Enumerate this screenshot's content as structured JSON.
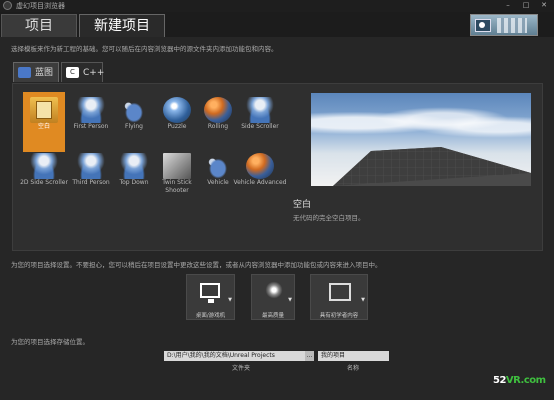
{
  "window": {
    "title": "虚幻项目浏览器",
    "controls": [
      "–",
      "□",
      "✕"
    ]
  },
  "tabs": [
    {
      "label": "项目",
      "active": false
    },
    {
      "label": "新建项目",
      "active": true
    }
  ],
  "description": "选择模板来作为新工程的基础。您可以随后在内容浏览器中的源文件夹内添加功能包和内容。",
  "blueprint_tabs": [
    {
      "label": "蓝图",
      "icon": "blueprint-icon",
      "active": true
    },
    {
      "label": "C++",
      "icon": "cpp-icon",
      "active": false
    }
  ],
  "templates": [
    {
      "label": "空白",
      "icon": "blank-template-icon",
      "selected": true
    },
    {
      "label": "First Person",
      "icon": "first-person-icon"
    },
    {
      "label": "Flying",
      "icon": "flying-icon"
    },
    {
      "label": "Puzzle",
      "icon": "puzzle-icon"
    },
    {
      "label": "Rolling",
      "icon": "rolling-icon"
    },
    {
      "label": "Side Scroller",
      "icon": "side-scroller-icon"
    },
    {
      "label": "2D Side Scroller",
      "icon": "2d-side-scroller-icon"
    },
    {
      "label": "Third Person",
      "icon": "third-person-icon"
    },
    {
      "label": "Top Down",
      "icon": "top-down-icon"
    },
    {
      "label": "Twin Stick Shooter",
      "icon": "twin-stick-shooter-icon"
    },
    {
      "label": "Vehicle",
      "icon": "vehicle-icon"
    },
    {
      "label": "Vehicle Advanced",
      "icon": "vehicle-advanced-icon"
    }
  ],
  "preview": {
    "title": "空白",
    "description": "无代码的完全空白项目。"
  },
  "settings_heading": "为您的项目选择设置。不要担心，您可以稍后在项目设置中更改这些设置，或者从内容浏览器中添加功能包或内容来进入项目中。",
  "settings": [
    {
      "label": "桌面/游戏机",
      "icon": "monitor-icon"
    },
    {
      "label": "最高质量",
      "icon": "quality-star-icon"
    },
    {
      "label": "具有初学者内容",
      "icon": "starter-content-icon"
    }
  ],
  "location_heading": "为您的项目选择存储位置。",
  "location": {
    "path": "D:\\用户\\我的\\我的文档\\Unreal Projects",
    "path_button": "…",
    "folder_label": "文件夹",
    "name": "我的项目",
    "name_label": "名称"
  },
  "watermark": {
    "prefix": "52",
    "text": "VR.com"
  }
}
